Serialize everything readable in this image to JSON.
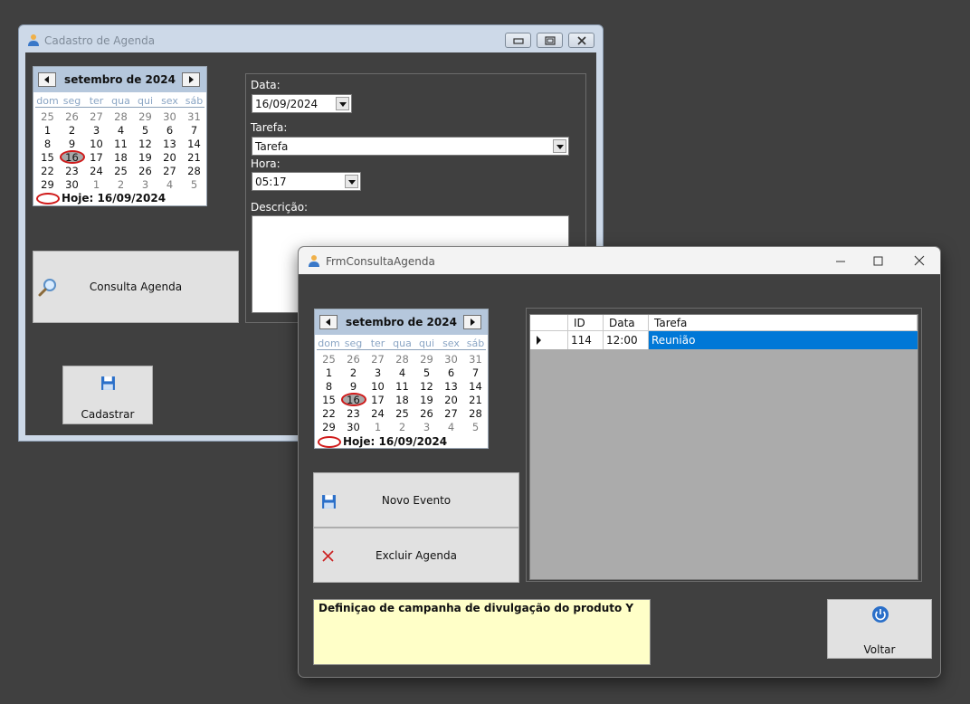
{
  "win1": {
    "title": "Cadastro de Agenda",
    "calendar": {
      "month": "setembro de 2024",
      "days_of_week": [
        "dom",
        "seg",
        "ter",
        "qua",
        "qui",
        "sex",
        "sáb"
      ],
      "weeks": [
        [
          "25",
          "26",
          "27",
          "28",
          "29",
          "30",
          "31"
        ],
        [
          "1",
          "2",
          "3",
          "4",
          "5",
          "6",
          "7"
        ],
        [
          "8",
          "9",
          "10",
          "11",
          "12",
          "13",
          "14"
        ],
        [
          "15",
          "16",
          "17",
          "18",
          "19",
          "20",
          "21"
        ],
        [
          "22",
          "23",
          "24",
          "25",
          "26",
          "27",
          "28"
        ],
        [
          "29",
          "30",
          "1",
          "2",
          "3",
          "4",
          "5"
        ]
      ],
      "selected_day": "16",
      "today_label": "Hoje: 16/09/2024"
    },
    "consulta_label": "Consulta Agenda",
    "cadastrar_label": "Cadastrar",
    "form": {
      "data_label": "Data:",
      "data_value": "16/09/2024",
      "tarefa_label": "Tarefa:",
      "tarefa_value": "Tarefa",
      "hora_label": "Hora:",
      "hora_value": "05:17",
      "descricao_label": "Descrição:"
    }
  },
  "win2": {
    "title": "FrmConsultaAgenda",
    "calendar": {
      "month": "setembro de 2024",
      "days_of_week": [
        "dom",
        "seg",
        "ter",
        "qua",
        "qui",
        "sex",
        "sáb"
      ],
      "weeks": [
        [
          "25",
          "26",
          "27",
          "28",
          "29",
          "30",
          "31"
        ],
        [
          "1",
          "2",
          "3",
          "4",
          "5",
          "6",
          "7"
        ],
        [
          "8",
          "9",
          "10",
          "11",
          "12",
          "13",
          "14"
        ],
        [
          "15",
          "16",
          "17",
          "18",
          "19",
          "20",
          "21"
        ],
        [
          "22",
          "23",
          "24",
          "25",
          "26",
          "27",
          "28"
        ],
        [
          "29",
          "30",
          "1",
          "2",
          "3",
          "4",
          "5"
        ]
      ],
      "selected_day": "16",
      "today_label": "Hoje: 16/09/2024"
    },
    "novo_evento_label": "Novo Evento",
    "excluir_label": "Excluir Agenda",
    "voltar_label": "Voltar",
    "description": "Definiçao de campanha de divulgação do produto Y",
    "grid": {
      "columns": [
        "ID",
        "Data",
        "Tarefa"
      ],
      "rows": [
        {
          "id": "114",
          "data": "12:00",
          "tarefa": "Reunião"
        }
      ]
    }
  },
  "colors": {
    "desktop": "#404040",
    "selection": "#0078d7",
    "calendar_header": "#b5c7dc",
    "today_circle": "#d01a1a",
    "description_bg": "#ffffc8"
  }
}
